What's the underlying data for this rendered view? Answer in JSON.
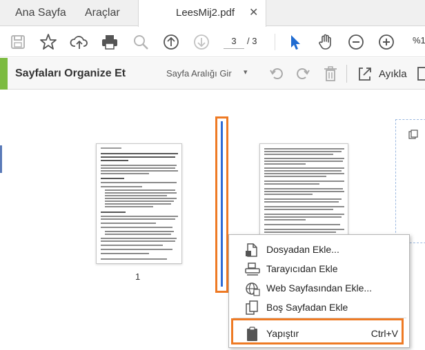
{
  "tabs": {
    "home": "Ana Sayfa",
    "tools": "Araçlar",
    "document": "LeesMij2.pdf",
    "close_glyph": "✕"
  },
  "toolbar": {
    "current_page": "3",
    "total_pages": "/ 3",
    "zoom": "%1"
  },
  "organize": {
    "title": "Sayfaları Organize Et",
    "range_placeholder": "Sayfa Aralığı Gir",
    "extract_label": "Ayıkla"
  },
  "canvas": {
    "page1_number": "1"
  },
  "context_menu": {
    "items": [
      {
        "label": "Dosyadan Ekle...",
        "icon": "file-add-icon"
      },
      {
        "label": "Tarayıcıdan Ekle",
        "icon": "scanner-icon"
      },
      {
        "label": "Web Sayfasından Ekle...",
        "icon": "web-page-icon"
      },
      {
        "label": "Boş Sayfadan Ekle",
        "icon": "blank-page-icon"
      },
      {
        "label": "Yapıştır",
        "shortcut": "Ctrl+V",
        "icon": "clipboard-icon"
      }
    ]
  },
  "colors": {
    "accent_green": "#7cbb40",
    "highlight_orange": "#ee7a24",
    "insert_blue": "#2d6bd6",
    "icon_gray": "#555555",
    "cursor_blue": "#1f6bd1"
  }
}
